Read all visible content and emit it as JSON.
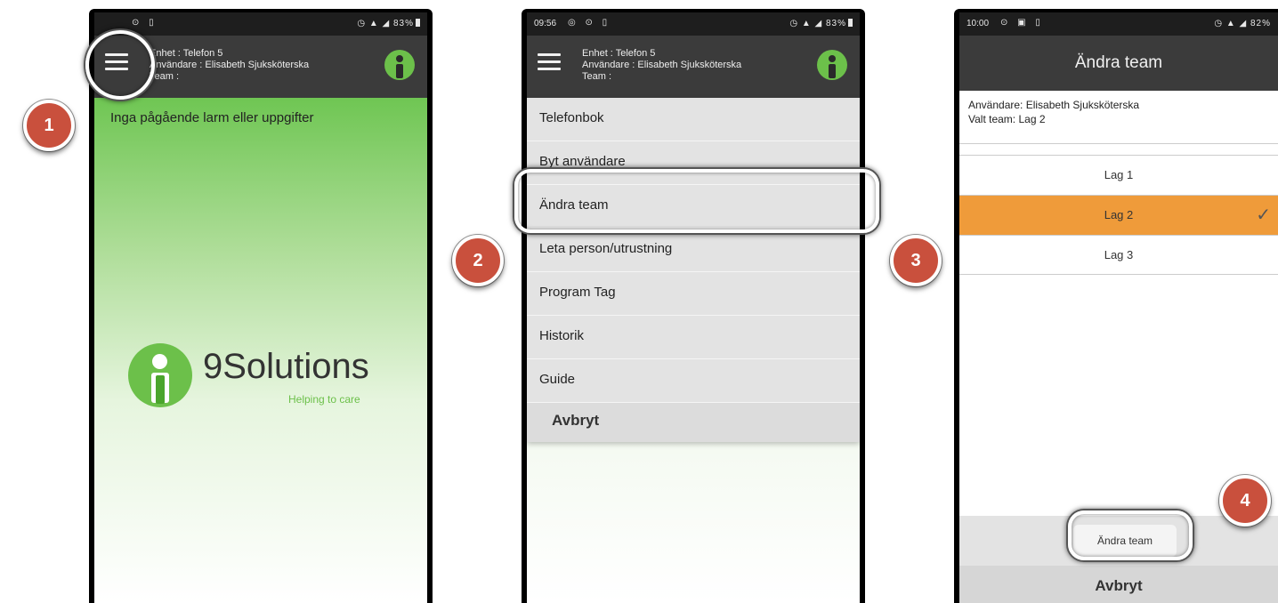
{
  "status_bars": {
    "phone1": {
      "time": "",
      "right": "83%"
    },
    "phone2": {
      "time": "09:56",
      "right": "83%"
    },
    "phone3": {
      "time": "10:00",
      "right": "82%"
    }
  },
  "device_header": {
    "unit": "Enhet : Telefon 5",
    "user": "Användare : Elisabeth Sjuksköterska",
    "team": "Team :"
  },
  "home": {
    "empty_message": "Inga pågående larm eller uppgifter"
  },
  "brand": {
    "name": "9Solutions",
    "tagline": "Helping to care"
  },
  "menu": {
    "items": [
      "Telefonbok",
      "Byt användare",
      "Ändra team",
      "Leta person/utrustning",
      "Program Tag",
      "Historik",
      "Guide"
    ],
    "cancel": "Avbryt"
  },
  "change_team": {
    "title": "Ändra team",
    "user_line": "Användare: Elisabeth Sjuksköterska",
    "selected_line": "Valt team: Lag 2",
    "teams": [
      "Lag 1",
      "Lag 2",
      "Lag 3"
    ],
    "selected_team": "Lag 2",
    "confirm_button": "Ändra team",
    "cancel_button": "Avbryt"
  },
  "markers": [
    "1",
    "2",
    "3",
    "4"
  ],
  "colors": {
    "brand_green": "#6cc04a",
    "selection_orange": "#ef9b3a",
    "marker_red": "#c9503d",
    "header_dark": "#3b3b3b"
  }
}
